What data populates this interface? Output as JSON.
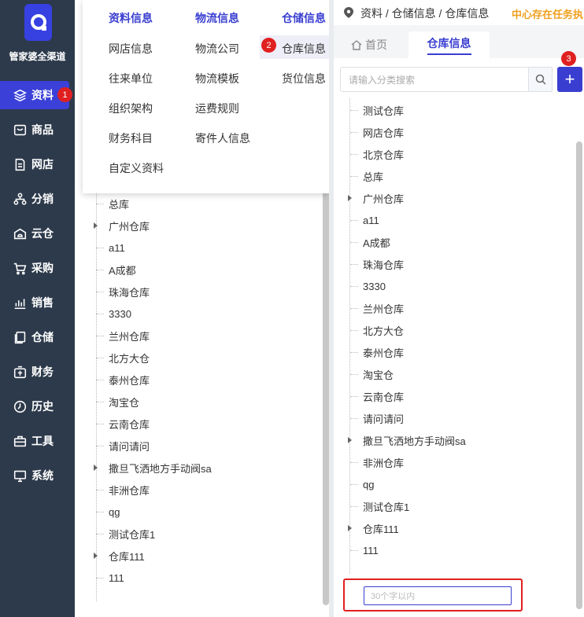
{
  "app": {
    "brand": "管家婆全渠道"
  },
  "sidebar": {
    "items": [
      {
        "label": "资料",
        "icon": "layers-icon",
        "active": true,
        "badge": "1"
      },
      {
        "label": "商品",
        "icon": "product-icon"
      },
      {
        "label": "网店",
        "icon": "document-icon"
      },
      {
        "label": "分销",
        "icon": "network-icon"
      },
      {
        "label": "云仓",
        "icon": "cloud-warehouse-icon"
      },
      {
        "label": "采购",
        "icon": "cart-icon"
      },
      {
        "label": "销售",
        "icon": "chart-icon"
      },
      {
        "label": "仓储",
        "icon": "storage-icon"
      },
      {
        "label": "财务",
        "icon": "finance-icon"
      },
      {
        "label": "历史",
        "icon": "clock-icon"
      },
      {
        "label": "工具",
        "icon": "toolbox-icon"
      },
      {
        "label": "系统",
        "icon": "monitor-icon"
      }
    ]
  },
  "menu": {
    "columns": [
      {
        "title": "资料信息",
        "items": [
          "网店信息",
          "往来单位",
          "组织架构",
          "财务科目",
          "自定义资料"
        ]
      },
      {
        "title": "物流信息",
        "items": [
          "物流公司",
          "物流模板",
          "运费规则",
          "寄件人信息"
        ]
      },
      {
        "title": "仓储信息",
        "items": [
          "仓库信息",
          "货位信息"
        ]
      }
    ],
    "badge": "2"
  },
  "left_tree": {
    "items": [
      "总库",
      "广州仓库",
      "a11",
      "A成都",
      "珠海仓库",
      "3330",
      "兰州仓库",
      "北方大仓",
      "泰州仓库",
      "淘宝仓",
      "云南仓库",
      "请问请问",
      "撒旦飞洒地方手动阀sa",
      "非洲仓库",
      "qg",
      "测试仓库1",
      "仓库111",
      "111"
    ]
  },
  "header": {
    "breadcrumb": "资料 / 仓储信息 / 仓库信息",
    "notice": "中心存在任务执"
  },
  "tabs": {
    "home": "首页",
    "active": "仓库信息"
  },
  "search": {
    "placeholder": "请输入分类搜索"
  },
  "add_button": {
    "label": "+",
    "badge": "3"
  },
  "right_tree": {
    "items": [
      "测试仓库",
      "网店仓库",
      "北京仓库",
      "总库",
      "广州仓库",
      "a11",
      "A成都",
      "珠海仓库",
      "3330",
      "兰州仓库",
      "北方大仓",
      "泰州仓库",
      "淘宝仓",
      "云南仓库",
      "请问请问",
      "撒旦飞洒地方手动阀sa",
      "非洲仓库",
      "qg",
      "测试仓库1",
      "仓库111",
      "111"
    ]
  },
  "new_item": {
    "placeholder": "30个字以内"
  }
}
